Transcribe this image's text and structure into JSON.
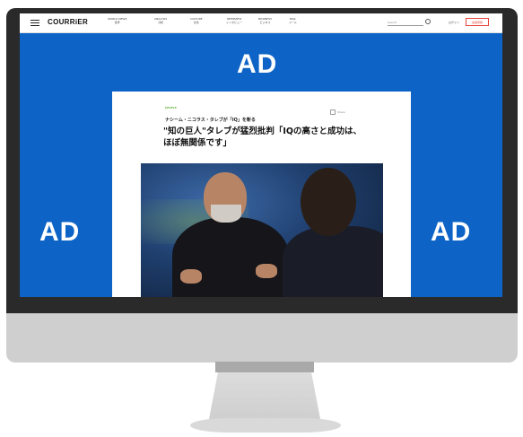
{
  "site": {
    "logo": "COURRiER",
    "nav": [
      {
        "line1": "WORLD NEWS",
        "line2": "世界"
      },
      {
        "line1": "ANALYSIS",
        "line2": "分析"
      },
      {
        "line1": "CULTURE",
        "line2": "文化"
      },
      {
        "line1": "INTERVIEW",
        "line2": "インタビュー"
      },
      {
        "line1": "BUSINESS",
        "line2": "ビジネス"
      },
      {
        "line1": "MAIL",
        "line2": "メール"
      }
    ],
    "search_placeholder": "Search",
    "login": "ログイン",
    "signup": "会員登録"
  },
  "ads": {
    "top": "AD",
    "left": "AD",
    "right": "AD"
  },
  "article": {
    "category": "PEOPLE",
    "share": "Share",
    "subhead": "ナシーム・ニコラス・タレブが「IQ」を斬る",
    "headline": "\"知の巨人\"タレブが猛烈批判「IQの高さと成功は、ほぼ無関係です」"
  }
}
